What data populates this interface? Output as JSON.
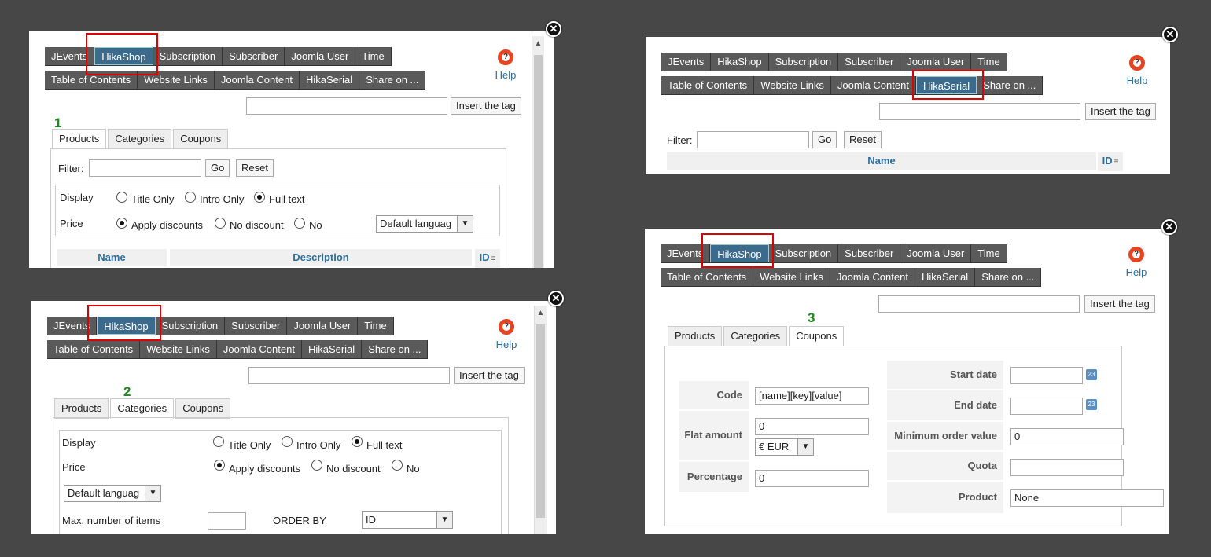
{
  "tabs_row1": [
    "JEvents",
    "HikaShop",
    "Subscription",
    "Subscriber",
    "Joomla User",
    "Time"
  ],
  "tabs_row2": [
    "Table of Contents",
    "Website Links",
    "Joomla Content",
    "HikaSerial",
    "Share on ..."
  ],
  "close_symbol": "✕",
  "help_label": "Help",
  "help_icon": "?",
  "insert_tag_label": "Insert the tag",
  "subtabs": [
    "Products",
    "Categories",
    "Coupons"
  ],
  "filter_label": "Filter:",
  "go_label": "Go",
  "reset_label": "Reset",
  "display_label": "Display",
  "price_label": "Price",
  "display_options": [
    "Title Only",
    "Intro Only",
    "Full text"
  ],
  "price_options": [
    "Apply discounts",
    "No discount",
    "No"
  ],
  "language_select": "Default languag",
  "dropdown_arrow": "▼",
  "sort_icon": "≡",
  "calendar_icon": "23",
  "scroll_up_arrow": "▲",
  "col_name": "Name",
  "col_description": "Description",
  "col_id": "ID",
  "step_numbers": [
    "1",
    "2",
    "3"
  ],
  "max_items_label": "Max. number of items",
  "order_by_label": "ORDER BY",
  "order_by_value": "ID",
  "coupons": {
    "code_label": "Code",
    "code_value": "[name][key][value]",
    "flat_amount_label": "Flat amount",
    "flat_amount_value": "0",
    "currency_value": "€ EUR",
    "percentage_label": "Percentage",
    "percentage_value": "0",
    "start_date_label": "Start date",
    "end_date_label": "End date",
    "min_order_label": "Minimum order value",
    "min_order_value": "0",
    "quota_label": "Quota",
    "product_label": "Product",
    "product_value": "None"
  },
  "colors": {
    "active_tab": "#3b6a8c",
    "highlight": "#e00000",
    "step_number": "#1c8a1c",
    "link": "#2b6ea1"
  }
}
